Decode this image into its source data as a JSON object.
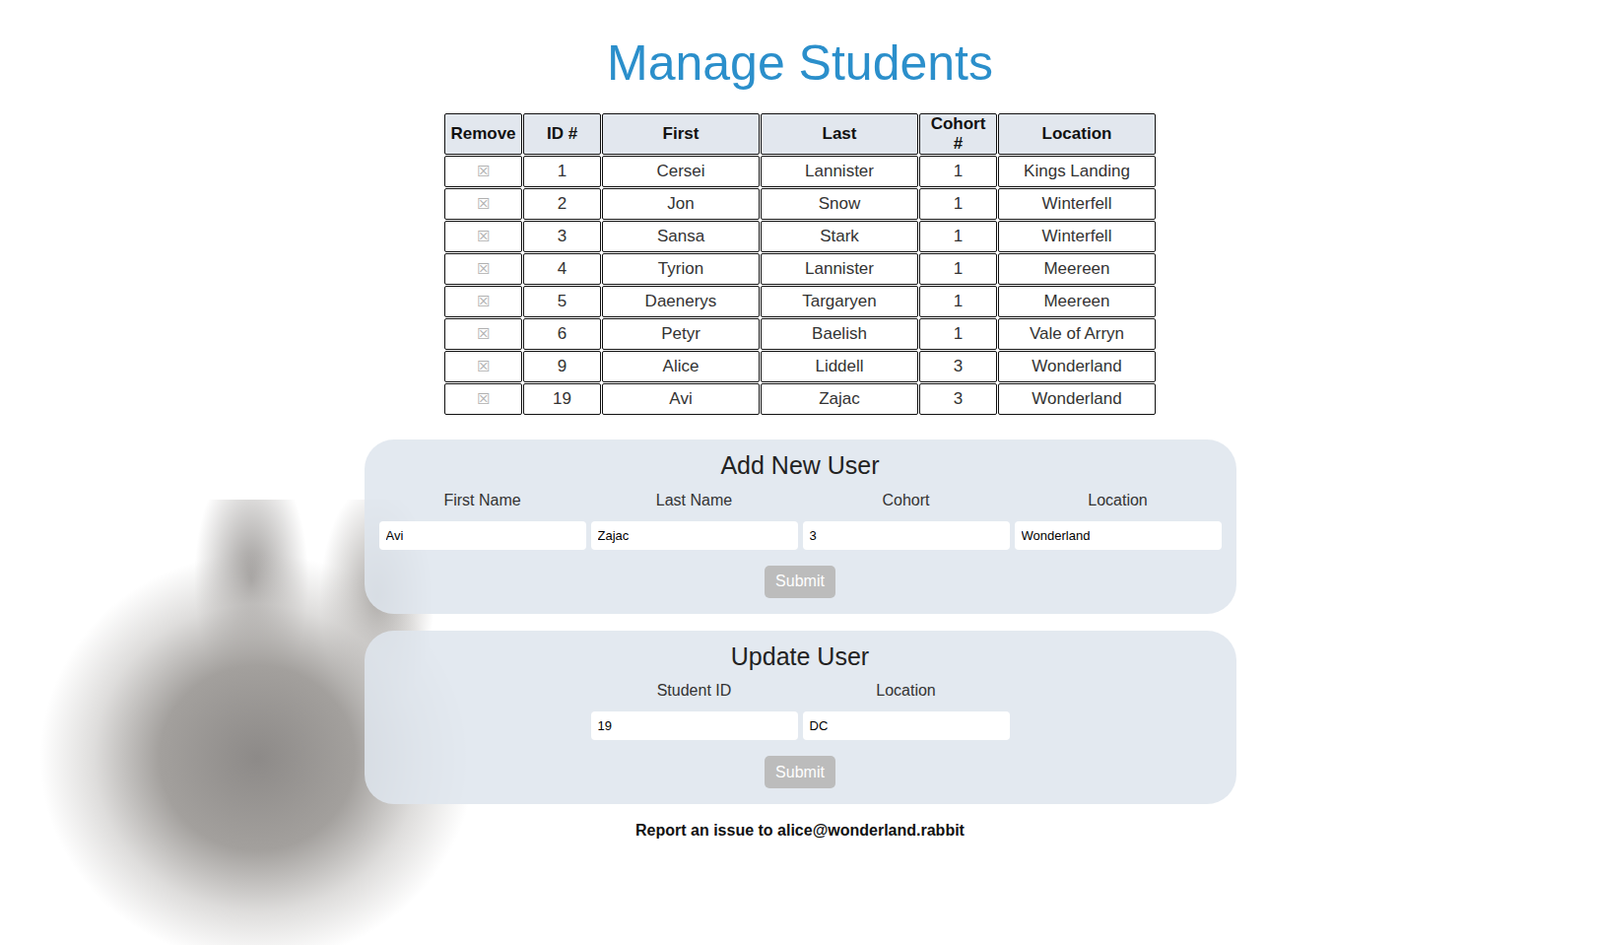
{
  "title": "Manage Students",
  "table": {
    "columns": [
      "Remove",
      "ID #",
      "First",
      "Last",
      "Cohort #",
      "Location"
    ],
    "rows": [
      {
        "remove": "☒",
        "cells": [
          "1",
          "Cersei",
          "Lannister",
          "1",
          "Kings Landing"
        ]
      },
      {
        "remove": "☒",
        "cells": [
          "2",
          "Jon",
          "Snow",
          "1",
          "Winterfell"
        ]
      },
      {
        "remove": "☒",
        "cells": [
          "3",
          "Sansa",
          "Stark",
          "1",
          "Winterfell"
        ]
      },
      {
        "remove": "☒",
        "cells": [
          "4",
          "Tyrion",
          "Lannister",
          "1",
          "Meereen"
        ]
      },
      {
        "remove": "☒",
        "cells": [
          "5",
          "Daenerys",
          "Targaryen",
          "1",
          "Meereen"
        ]
      },
      {
        "remove": "☒",
        "cells": [
          "6",
          "Petyr",
          "Baelish",
          "1",
          "Vale of Arryn"
        ]
      },
      {
        "remove": "☒",
        "cells": [
          "9",
          "Alice",
          "Liddell",
          "3",
          "Wonderland"
        ]
      },
      {
        "remove": "☒",
        "cells": [
          "19",
          "Avi",
          "Zajac",
          "3",
          "Wonderland"
        ]
      }
    ]
  },
  "add_form": {
    "title": "Add New User",
    "fields": [
      {
        "label": "First Name",
        "value": "Avi"
      },
      {
        "label": "Last Name",
        "value": "Zajac"
      },
      {
        "label": "Cohort",
        "value": "3"
      },
      {
        "label": "Location",
        "value": "Wonderland"
      }
    ],
    "submit": {
      "label": "Submit",
      "disabled": true
    }
  },
  "update_form": {
    "title": "Update User",
    "fields": [
      {
        "label": "Student ID",
        "value": "19"
      },
      {
        "label": "Location",
        "value": "DC"
      }
    ],
    "submit": {
      "label": "Submit",
      "disabled": true
    }
  },
  "footer": "Report an issue to alice@wonderland.rabbit"
}
